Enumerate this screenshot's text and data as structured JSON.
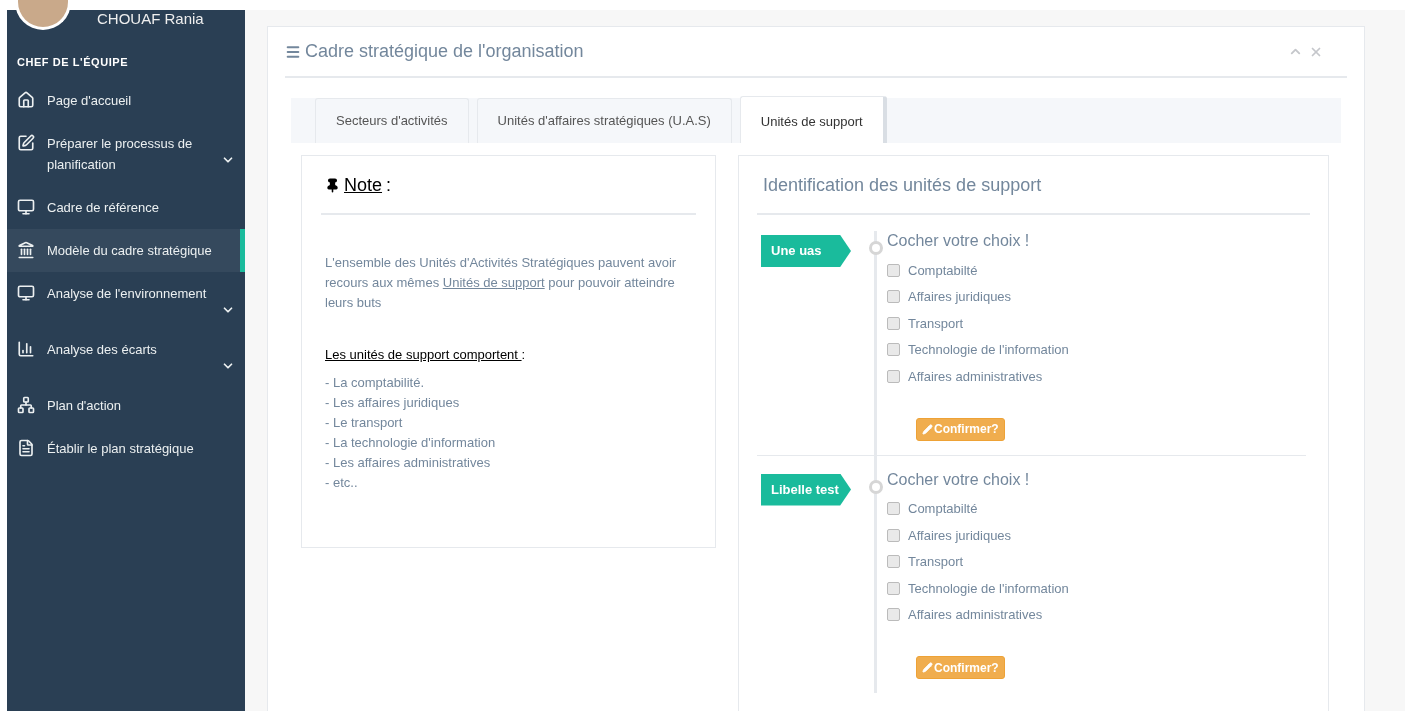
{
  "sidebar": {
    "user_name": "CHOUAF Rania",
    "section_title": "CHEF DE L'ÉQUIPE",
    "items": [
      {
        "label": "Page d'accueil",
        "expandable": false,
        "selected": false
      },
      {
        "label": "Préparer le processus de planification",
        "expandable": true,
        "selected": false
      },
      {
        "label": "Cadre de référence",
        "expandable": false,
        "selected": false
      },
      {
        "label": "Modèle du cadre stratégique",
        "expandable": false,
        "selected": true
      },
      {
        "label": "Analyse de l'environnement",
        "expandable": true,
        "selected": false
      },
      {
        "label": "Analyse des écarts",
        "expandable": true,
        "selected": false
      },
      {
        "label": "Plan d'action",
        "expandable": false,
        "selected": false
      },
      {
        "label": "Établir le plan stratégique",
        "expandable": false,
        "selected": false
      }
    ]
  },
  "panel": {
    "title": "Cadre stratégique de l'organisation",
    "tabs": [
      {
        "label": "Secteurs d'activités",
        "selected": false
      },
      {
        "label": "Unités d'affaires stratégiques (U.A.S)",
        "selected": false
      },
      {
        "label": "Unités de support",
        "selected": true
      }
    ],
    "note": {
      "title": "Note",
      "title_suffix": ":",
      "text_before": "L'ensemble des Unités d'Activités Stratégiques pauvent avoir recours aux mêmes",
      "link": "Unités de support",
      "text_after": "pour pouvoir atteindre leurs buts",
      "list_heading": "Les unités de support comportent ",
      "list_heading_suffix": ":",
      "list": [
        "- La comptabilité.",
        "- Les affaires juridiques",
        "- Le transport",
        "- La technologie d'information",
        "- Les affaires administratives",
        "- etc.."
      ]
    },
    "identification": {
      "title": "Identification des unités de support",
      "entries": [
        {
          "tag": "Une uas",
          "heading": "Cocher votre choix !",
          "button": "Confirmer?",
          "options": [
            {
              "label": "Comptabilté",
              "checked": false
            },
            {
              "label": "Affaires juridiques",
              "checked": false
            },
            {
              "label": "Transport",
              "checked": false
            },
            {
              "label": "Technologie de l'information",
              "checked": false
            },
            {
              "label": "Affaires administratives",
              "checked": false
            }
          ]
        },
        {
          "tag": "Libelle test",
          "heading": "Cocher votre choix !",
          "button": "Confirmer?",
          "options": [
            {
              "label": "Comptabilté",
              "checked": false
            },
            {
              "label": "Affaires juridiques",
              "checked": false
            },
            {
              "label": "Transport",
              "checked": false
            },
            {
              "label": "Technologie de l'information",
              "checked": false
            },
            {
              "label": "Affaires administratives",
              "checked": false
            }
          ]
        }
      ]
    }
  }
}
